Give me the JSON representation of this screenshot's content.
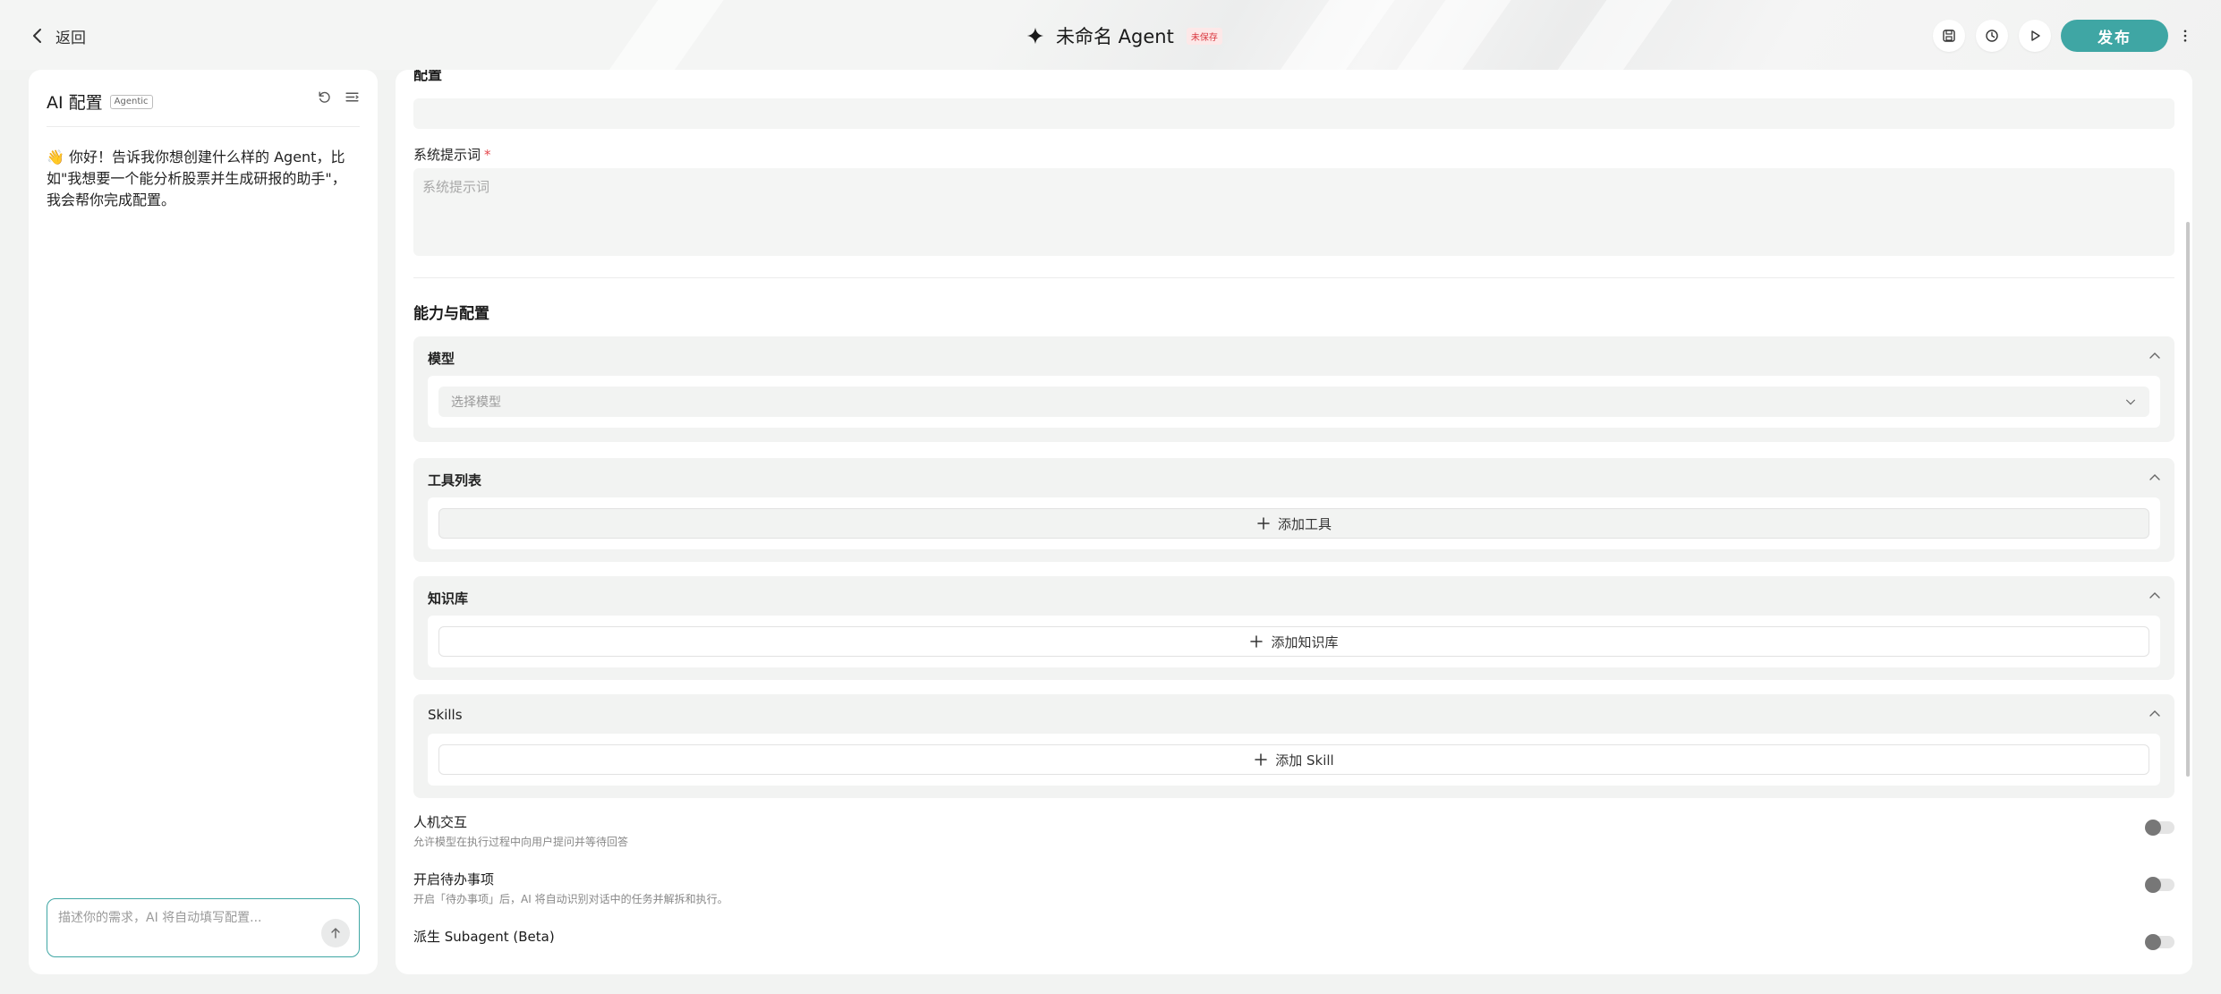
{
  "header": {
    "back_label": "返回",
    "title": "未命名 Agent",
    "unsaved_badge": "未保存",
    "publish_label": "发布"
  },
  "ai_panel": {
    "title": "AI 配置",
    "badge": "Agentic",
    "greeting": "👋 你好！告诉我你想创建什么样的 Agent，比如\"我想要一个能分析股票并生成研报的助手\"，我会帮你完成配置。",
    "input_placeholder": "描述你的需求，AI 将自动填写配置..."
  },
  "config": {
    "section_title_cut": "配置",
    "system_prompt_label": "系统提示词",
    "system_prompt_required": "*",
    "system_prompt_placeholder": "系统提示词",
    "capabilities_title": "能力与配置",
    "model": {
      "title": "模型",
      "select_placeholder": "选择模型"
    },
    "tools": {
      "title": "工具列表",
      "add_label": "添加工具"
    },
    "knowledge": {
      "title": "知识库",
      "add_label": "添加知识库"
    },
    "skills": {
      "title": "Skills",
      "add_label": "添加 Skill"
    },
    "toggles": [
      {
        "label": "人机交互",
        "desc": "允许模型在执行过程中向用户提问并等待回答",
        "on": false
      },
      {
        "label": "开启待办事项",
        "desc": "开启「待办事项」后，AI 将自动识别对话中的任务并解拆和执行。",
        "on": false
      },
      {
        "label": "派生 Subagent (Beta)",
        "desc": "",
        "on": false
      }
    ]
  },
  "colors": {
    "accent": "#3fa6a4",
    "danger": "#e5484d"
  }
}
